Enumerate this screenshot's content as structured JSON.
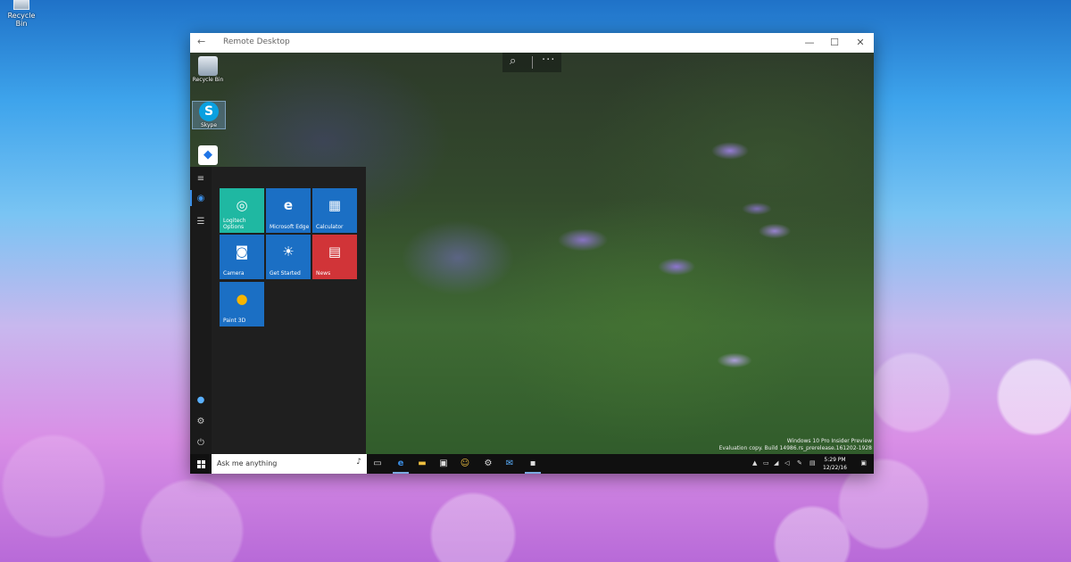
{
  "host_desktop": {
    "recycle_bin_label": "Recycle Bin"
  },
  "window": {
    "title": "Remote Desktop",
    "back_glyph": "←",
    "minimize_glyph": "—",
    "maximize_glyph": "☐",
    "close_glyph": "✕"
  },
  "remote": {
    "desktop_icons": [
      {
        "label": "Recycle Bin",
        "icon": "recycle-bin-icon"
      },
      {
        "label": "Skype",
        "icon": "skype-icon"
      },
      {
        "label": "",
        "icon": "dropbox-icon"
      }
    ],
    "tiles": [
      {
        "label": "Logitech Options",
        "icon": "logitech-icon",
        "color": "#1fb8a2"
      },
      {
        "label": "Microsoft Edge",
        "icon": "edge-icon",
        "color": "#1b6fc4"
      },
      {
        "label": "Calculator",
        "icon": "calculator-icon",
        "color": "#1b6fc4"
      },
      {
        "label": "Camera",
        "icon": "camera-icon",
        "color": "#1b6fc4"
      },
      {
        "label": "Get Started",
        "icon": "lightbulb-icon",
        "color": "#1b6fc4"
      },
      {
        "label": "News",
        "icon": "news-icon",
        "color": "#d13438"
      },
      {
        "label": "Paint 3D",
        "icon": "paint3d-icon",
        "color": "#1b6fc4"
      }
    ],
    "watermark": {
      "line1": "Windows 10 Pro Insider Preview",
      "line2": "Evaluation copy. Build 14986.rs_prerelease.161202-1928"
    },
    "taskbar": {
      "search_placeholder": "Ask me anything",
      "clock_time": "5:29 PM",
      "clock_date": "12/22/16"
    }
  }
}
